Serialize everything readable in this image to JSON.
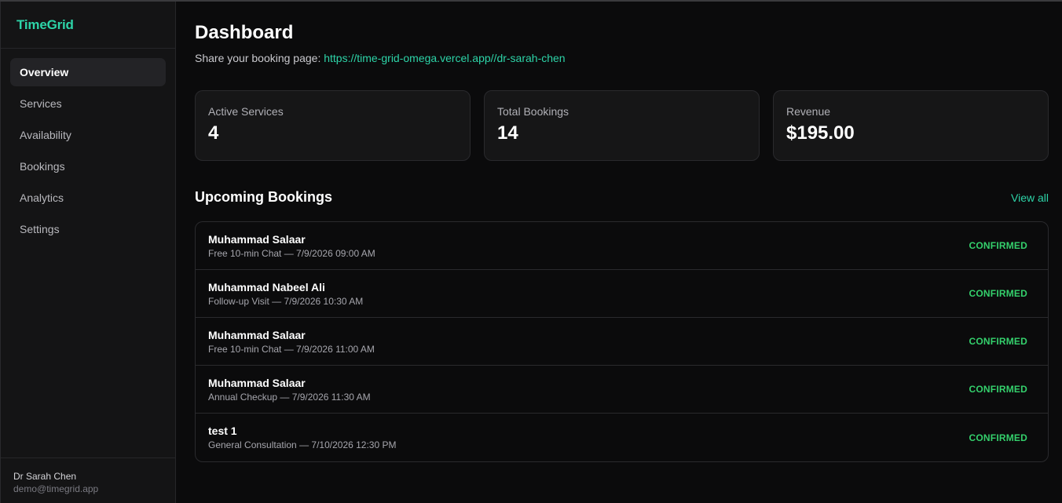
{
  "app": {
    "name": "TimeGrid"
  },
  "sidebar": {
    "items": [
      {
        "label": "Overview",
        "active": true
      },
      {
        "label": "Services"
      },
      {
        "label": "Availability"
      },
      {
        "label": "Bookings"
      },
      {
        "label": "Analytics"
      },
      {
        "label": "Settings"
      }
    ],
    "user": {
      "name": "Dr Sarah Chen",
      "email": "demo@timegrid.app"
    }
  },
  "main": {
    "title": "Dashboard",
    "share_prefix": "Share your booking page: ",
    "share_url": "https://time-grid-omega.vercel.app//dr-sarah-chen",
    "stats": [
      {
        "label": "Active Services",
        "value": "4"
      },
      {
        "label": "Total Bookings",
        "value": "14"
      },
      {
        "label": "Revenue",
        "value": "$195.00"
      }
    ],
    "upcoming": {
      "title": "Upcoming Bookings",
      "view_all": "View all",
      "rows": [
        {
          "name": "Muhammad Salaar",
          "detail": "Free 10-min Chat — 7/9/2026 09:00 AM",
          "status": "CONFIRMED"
        },
        {
          "name": "Muhammad Nabeel Ali",
          "detail": "Follow-up Visit — 7/9/2026 10:30 AM",
          "status": "CONFIRMED"
        },
        {
          "name": "Muhammad Salaar",
          "detail": "Free 10-min Chat — 7/9/2026 11:00 AM",
          "status": "CONFIRMED"
        },
        {
          "name": "Muhammad Salaar",
          "detail": "Annual Checkup — 7/9/2026 11:30 AM",
          "status": "CONFIRMED"
        },
        {
          "name": "test 1",
          "detail": "General Consultation — 7/10/2026 12:30 PM",
          "status": "CONFIRMED"
        }
      ]
    }
  },
  "colors": {
    "accent": "#2dd4a8",
    "status_confirmed": "#34d06c",
    "background": "#0b0b0c",
    "sidebar": "#141415"
  }
}
